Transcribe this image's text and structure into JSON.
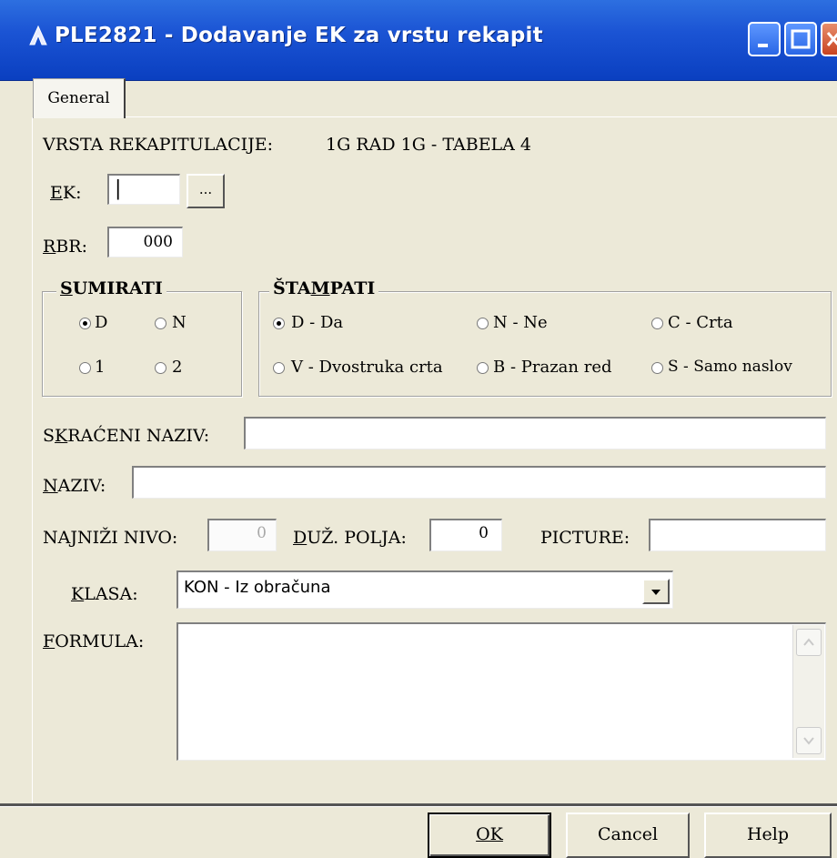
{
  "window": {
    "title": "PLE2821 - Dodavanje EK za vrstu rekapit"
  },
  "tabs": [
    {
      "label": "General"
    }
  ],
  "vrsta": {
    "label": "VRSTA REKAPITULACIJE:",
    "value": "1G RAD 1G - TABELA 4"
  },
  "ek": {
    "label": "EK:",
    "value": "|",
    "browse_label": "..."
  },
  "rbr": {
    "label": "RBR:",
    "value": "000"
  },
  "sumirati": {
    "legend": "SUMIRATI",
    "options": [
      {
        "label": "D",
        "selected": true
      },
      {
        "label": "N",
        "selected": false
      },
      {
        "label": "1",
        "selected": false
      },
      {
        "label": "2",
        "selected": false
      }
    ]
  },
  "stampati": {
    "legend": "ŠTAMPATI",
    "options": [
      {
        "label": "D - Da",
        "selected": true
      },
      {
        "label": "N - Ne",
        "selected": false
      },
      {
        "label": "C - Crta",
        "selected": false
      },
      {
        "label": "V - Dvostruka crta",
        "selected": false
      },
      {
        "label": "B - Prazan red",
        "selected": false
      },
      {
        "label": "S - Samo naslov",
        "selected": false
      }
    ]
  },
  "skraceni_naziv": {
    "label": "SKRAĆENI NAZIV:",
    "value": ""
  },
  "naziv": {
    "label": "NAZIV:",
    "value": ""
  },
  "najnizi_nivo": {
    "label": "NAJNIŽI NIVO:",
    "value": "0"
  },
  "duz_polja": {
    "label": "DUŽ. POLJA:",
    "value": "0"
  },
  "picture": {
    "label": "PICTURE:",
    "value": ""
  },
  "klasa": {
    "label": "KLASA:",
    "value": "KON - Iz obračuna"
  },
  "formula": {
    "label": "FORMULA:",
    "value": ""
  },
  "buttons": {
    "ok": "OK",
    "cancel": "Cancel",
    "help": "Help"
  },
  "colors": {
    "titlebar": "#1b54d4",
    "dialog_bg": "#ece9d8"
  }
}
